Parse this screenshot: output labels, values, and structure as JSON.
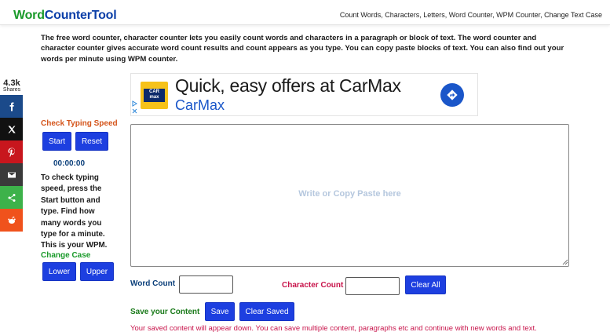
{
  "header": {
    "logo_part1": "Word",
    "logo_part2": "CounterTool",
    "nav": "Count Words, Characters, Letters, Word Counter, WPM Counter, Change Text Case"
  },
  "intro": "The free word counter, character counter lets you easily count words and characters in a paragraph or block of text. The word counter and character counter gives accurate word count results and count appears as you type. You can copy paste blocks of text. You can also find out your words per minute using WPM counter.",
  "share": {
    "count": "4.3k",
    "label": "Shares",
    "buttons": [
      "facebook-icon",
      "x-icon",
      "pinterest-icon",
      "email-icon",
      "share-icon",
      "reddit-icon"
    ],
    "colors": {
      "facebook": "#1b4a8a",
      "x": "#111111",
      "pinterest": "#c8161d",
      "email": "#3a3a3a",
      "share": "#3db24a",
      "reddit": "#f0521c"
    }
  },
  "typing": {
    "title": "Check Typing Speed",
    "start_label": "Start",
    "reset_label": "Reset",
    "timer": "00:00:00",
    "help": "To check typing speed, press the Start button and type. Find how many words you type for a minute. This is your WPM."
  },
  "case": {
    "title": "Change Case",
    "lower_label": "Lower",
    "upper_label": "Upper"
  },
  "ad": {
    "logo_line1": "CAR",
    "logo_line2": "max",
    "headline": "Quick, easy offers at CarMax",
    "brand": "CarMax",
    "arrow_icon": "directions-arrow-icon"
  },
  "editor": {
    "placeholder": "Write or Copy Paste here",
    "value": ""
  },
  "counts": {
    "word_label": "Word Count",
    "word_value": "",
    "char_label": "Character Count",
    "char_value": "",
    "clear_all_label": "Clear All"
  },
  "save": {
    "label": "Save your Content",
    "save_label": "Save",
    "clear_saved_label": "Clear Saved",
    "note": "Your saved content will appear down. You can save multiple content, paragraphs etc and continue with new words and text."
  },
  "colors": {
    "button_blue": "#1d3fe0",
    "logo_green": "#1a9a2a",
    "logo_blue": "#0b3fa8",
    "accent_orange": "#d4541a",
    "accent_red": "#c8144b"
  }
}
